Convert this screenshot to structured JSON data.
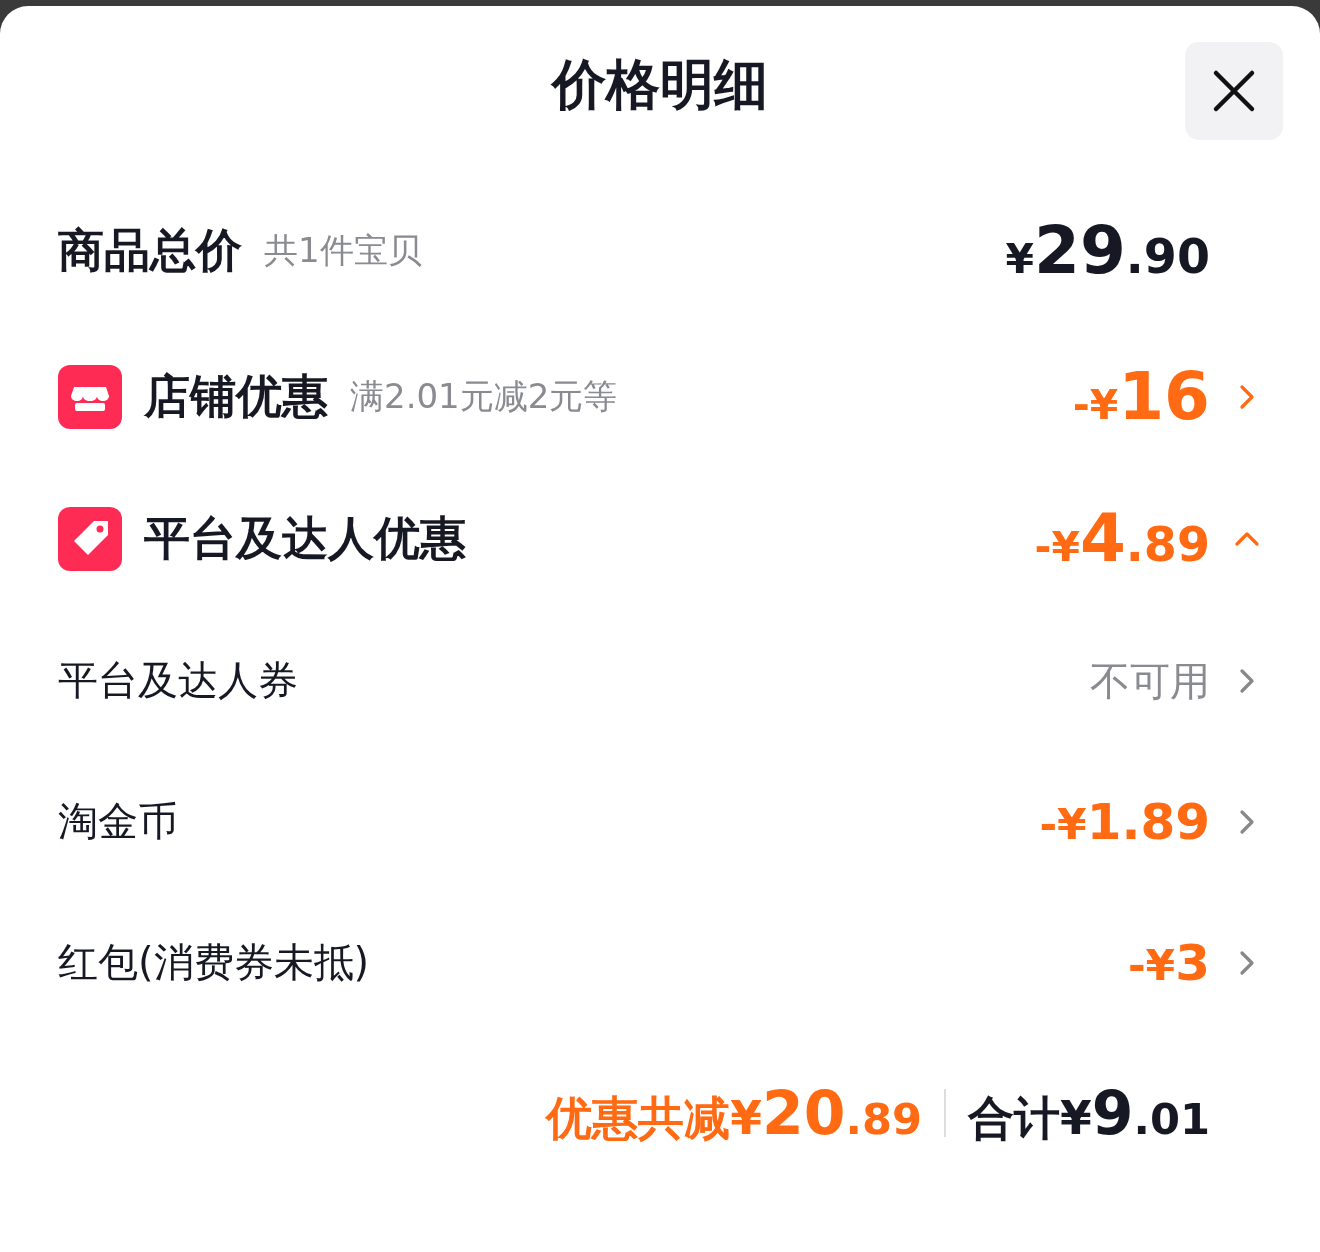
{
  "title": "价格明细",
  "summary": {
    "label": "商品总价",
    "note": "共1件宝贝",
    "amount": "¥29.90"
  },
  "rows": [
    {
      "kind": "store",
      "label": "店铺优惠",
      "note": "满2.01元减2元等",
      "amount": "-¥16",
      "muted": false,
      "expanded": false
    },
    {
      "kind": "tag",
      "label": "平台及达人优惠",
      "amount": "-¥4.89",
      "muted": false,
      "expanded": true
    },
    {
      "kind": "item",
      "label": "平台及达人券",
      "amount": "不可用",
      "muted": true,
      "expanded": false
    },
    {
      "kind": "item",
      "label": "淘金币",
      "amount": "-¥1.89",
      "muted": false,
      "expanded": false
    },
    {
      "kind": "item",
      "label": "红包(消费券未抵)",
      "amount": "-¥3",
      "muted": false,
      "expanded": false
    }
  ],
  "footer": {
    "savings": "优惠共减¥20.89",
    "total": "合计¥9.01"
  }
}
